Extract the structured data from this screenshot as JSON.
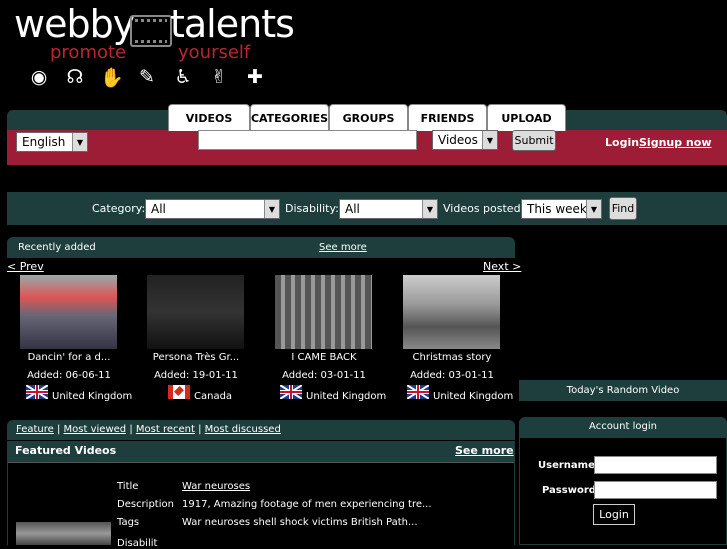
{
  "logo": {
    "word1": "webby",
    "word2": "talents",
    "slogan1": "promote",
    "slogan2": "yourself",
    "accessibility_icons": [
      "eye-icon",
      "ear-icon",
      "hand-sign-icon",
      "cognitive-icon",
      "wheelchair-icon",
      "sign-language-icon",
      "puzzle-icon"
    ]
  },
  "nav": {
    "tabs": [
      "VIDEOS",
      "CATEGORIES",
      "GROUPS",
      "FRIENDS",
      "UPLOAD"
    ]
  },
  "topbar": {
    "language": "English",
    "search_value": "",
    "search_type": "Videos",
    "submit": "Submit",
    "login": "Login",
    "signup": "Signup now"
  },
  "filters": {
    "category_label": "Category:",
    "category_value": "All",
    "disability_label": "Disability:",
    "disability_value": "All",
    "posted_label": "Videos posted:",
    "posted_value": "This week",
    "find": "Find"
  },
  "recent": {
    "title": "Recently added",
    "see_more": "See more",
    "prev": "< Prev",
    "next": "Next >",
    "videos": [
      {
        "title": "Dancin' for a d...",
        "added": "Added: 06-06-11",
        "country": "United Kingdom"
      },
      {
        "title": "Persona Très Gr...",
        "added": "Added: 19-01-11",
        "country": "Canada"
      },
      {
        "title": "I CAME BACK",
        "added": "Added: 03-01-11",
        "country": "United Kingdom"
      },
      {
        "title": "Christmas story",
        "added": "Added: 03-01-11",
        "country": "United Kingdom"
      }
    ]
  },
  "random": {
    "title": "Today's Random Video"
  },
  "featured": {
    "links": [
      "Feature",
      "Most viewed",
      "Most recent",
      "Most discussed"
    ],
    "separator": "|",
    "heading": "Featured Videos",
    "see_more": "See more",
    "title_label": "Title",
    "title_value": "War neuroses",
    "desc_label": "Description",
    "desc_value": "1917, Amazing footage of men experiencing tre...",
    "tags_label": "Tags",
    "tags_value": "War neuroses shell shock victims British Path...",
    "more_label": "Disabilit"
  },
  "account": {
    "title": "Account login",
    "username_label": "Username",
    "password_label": "Password",
    "login_button": "Login"
  }
}
